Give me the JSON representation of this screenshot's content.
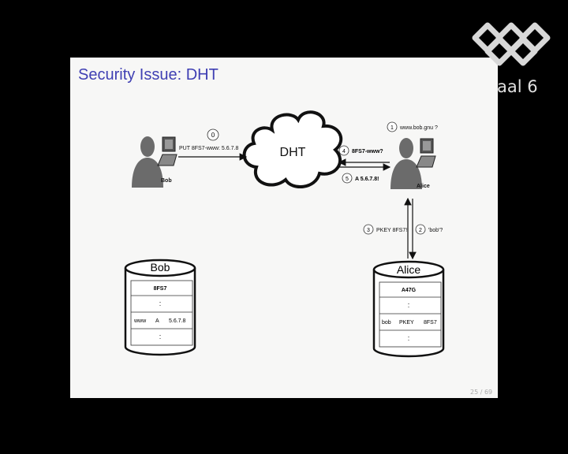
{
  "slide": {
    "title": "Security Issue: DHT",
    "page_number": "25 / 69"
  },
  "overlay": {
    "channel_label": "aal 6"
  },
  "diagram": {
    "cloud_label": "DHT",
    "bob_label": "Bob",
    "alice_label": "Alice",
    "steps": [
      {
        "number": "0",
        "text": "PUT 8FS7-www: 5.6.7.8"
      },
      {
        "number": "1",
        "text": "www.bob.gnu ?"
      },
      {
        "number": "2",
        "text": "'bob'?"
      },
      {
        "number": "3",
        "text": "PKEY 8FS7!"
      },
      {
        "number": "4",
        "text": "8FS7-www?"
      },
      {
        "number": "5",
        "text": "A 5.6.7.8!"
      }
    ],
    "bob_db": {
      "title": "Bob",
      "zone": "8FS7",
      "dots": ":",
      "record": {
        "name": "www",
        "type": "A",
        "value": "5.6.7.8"
      }
    },
    "alice_db": {
      "title": "Alice",
      "zone": "A47G",
      "dots": ":",
      "record": {
        "name": "bob",
        "type": "PKEY",
        "value": "8FS7"
      }
    }
  }
}
